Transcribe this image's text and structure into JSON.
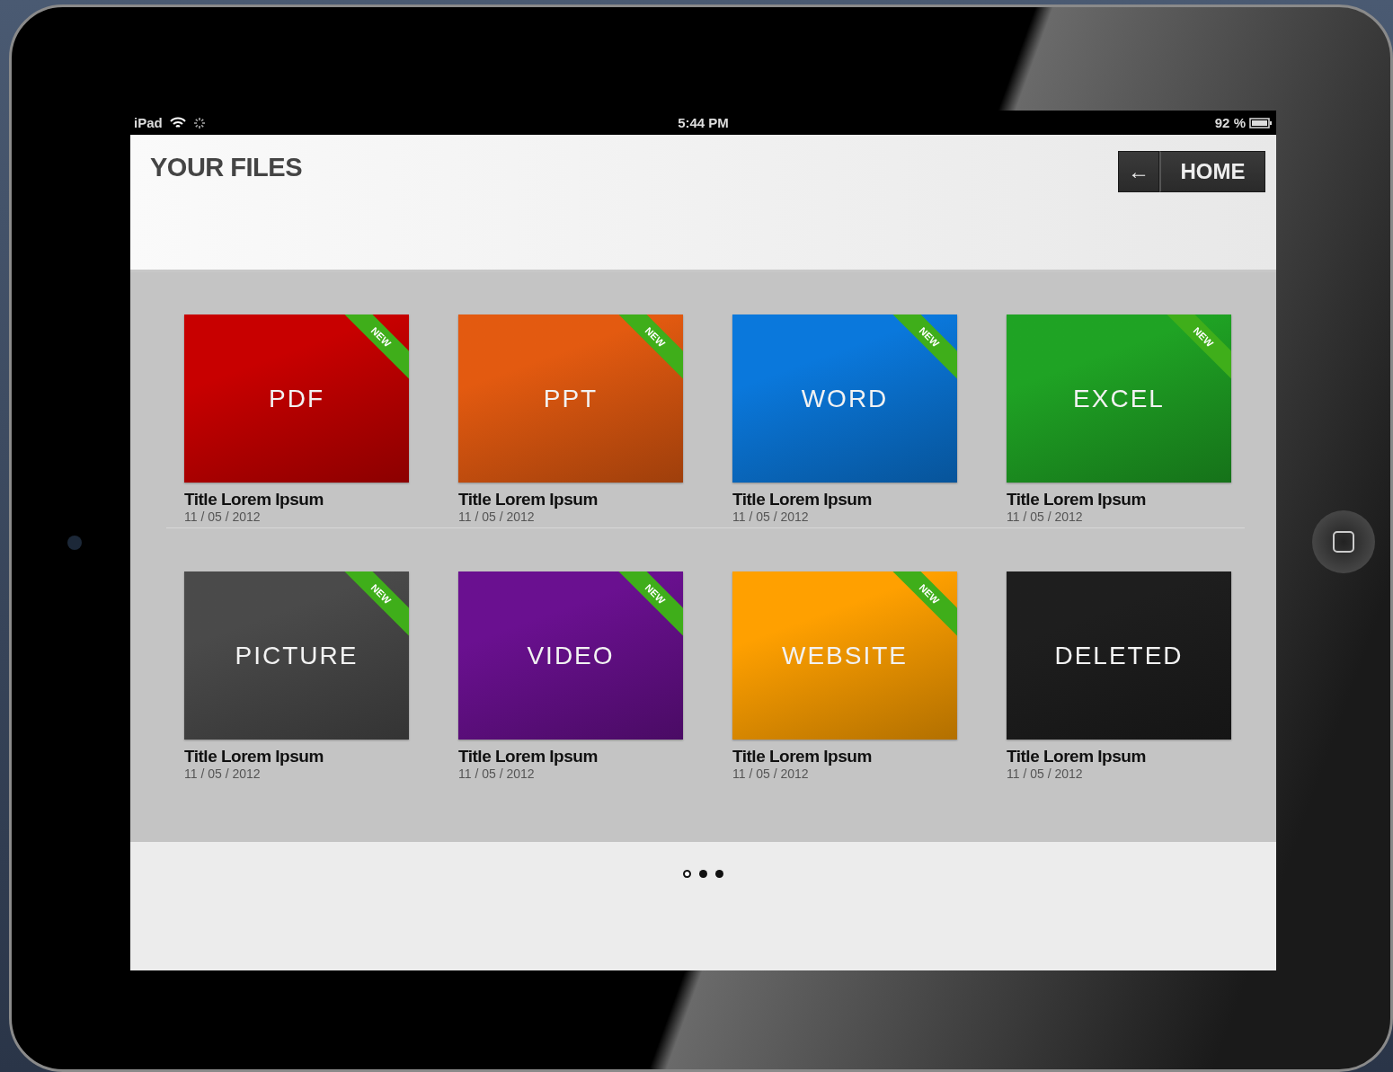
{
  "status_bar": {
    "device": "iPad",
    "time": "5:44 PM",
    "battery": "92 %"
  },
  "header": {
    "title": "YOUR FILES",
    "back_button": "←",
    "home_button": "HOME"
  },
  "files": [
    {
      "label": "PDF",
      "color": "#c80000",
      "badge": "NEW",
      "title": "Title Lorem Ipsum",
      "date": "11 / 05 / 2012"
    },
    {
      "label": "PPT",
      "color": "#e35a10",
      "badge": "NEW",
      "title": "Title Lorem Ipsum",
      "date": "11 / 05 / 2012"
    },
    {
      "label": "WORD",
      "color": "#0a78dc",
      "badge": "NEW",
      "title": "Title Lorem Ipsum",
      "date": "11 / 05 / 2012"
    },
    {
      "label": "EXCEL",
      "color": "#1fa324",
      "badge": "NEW",
      "title": "Title Lorem Ipsum",
      "date": "11 / 05 / 2012"
    },
    {
      "label": "PICTURE",
      "color": "#4a4a4a",
      "badge": "NEW",
      "title": "Title Lorem Ipsum",
      "date": "11 / 05 / 2012"
    },
    {
      "label": "VIDEO",
      "color": "#6a1090",
      "badge": "NEW",
      "title": "Title Lorem Ipsum",
      "date": "11 / 05 / 2012"
    },
    {
      "label": "WEBSITE",
      "color": "#ffa000",
      "badge": "NEW",
      "title": "Title Lorem Ipsum",
      "date": "11 / 05 / 2012"
    },
    {
      "label": "DELETED",
      "color": "#1e1e1e",
      "title": "Title Lorem Ipsum",
      "date": "11 / 05 / 2012"
    }
  ],
  "pages": [
    {
      "selected": true
    },
    {
      "selected": false
    },
    {
      "selected": false
    }
  ]
}
